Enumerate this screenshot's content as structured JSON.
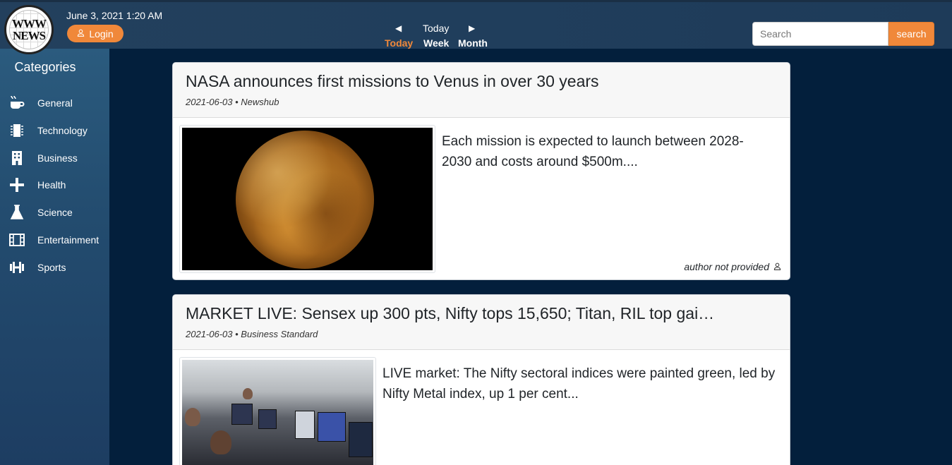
{
  "header": {
    "logo_text": "WWW NEWS",
    "datetime": "June 3, 2021 1:20 AM",
    "login_label": "Login",
    "period": {
      "current": "Today",
      "options": [
        "Today",
        "Week",
        "Month"
      ],
      "active": "Today"
    },
    "search": {
      "placeholder": "Search",
      "button_label": "search"
    }
  },
  "sidebar": {
    "title": "Categories",
    "items": [
      {
        "label": "General",
        "icon": "coffee-icon"
      },
      {
        "label": "Technology",
        "icon": "chip-icon"
      },
      {
        "label": "Business",
        "icon": "building-icon"
      },
      {
        "label": "Health",
        "icon": "plus-icon"
      },
      {
        "label": "Science",
        "icon": "flask-icon"
      },
      {
        "label": "Entertainment",
        "icon": "film-icon"
      },
      {
        "label": "Sports",
        "icon": "dumbbell-icon"
      }
    ]
  },
  "articles": [
    {
      "title": "NASA announces first missions to Venus in over 30 years",
      "meta": "2021-06-03 • Newshub",
      "description": "Each mission is expected to launch between 2028-2030 and costs around $500m....",
      "author": "author not provided",
      "image": "venus-planet-image"
    },
    {
      "title": "MARKET LIVE: Sensex up 300 pts, Nifty tops 15,650; Titan, RIL top gai…",
      "meta": "2021-06-03 • Business Standard",
      "description": "LIVE market: The Nifty sectoral indices were painted green, led by Nifty Metal index, up 1 per cent...",
      "image": "trading-floor-image"
    }
  ],
  "colors": {
    "accent": "#f0883a",
    "topbar": "#203e5c",
    "page_bg": "#031f3c"
  }
}
